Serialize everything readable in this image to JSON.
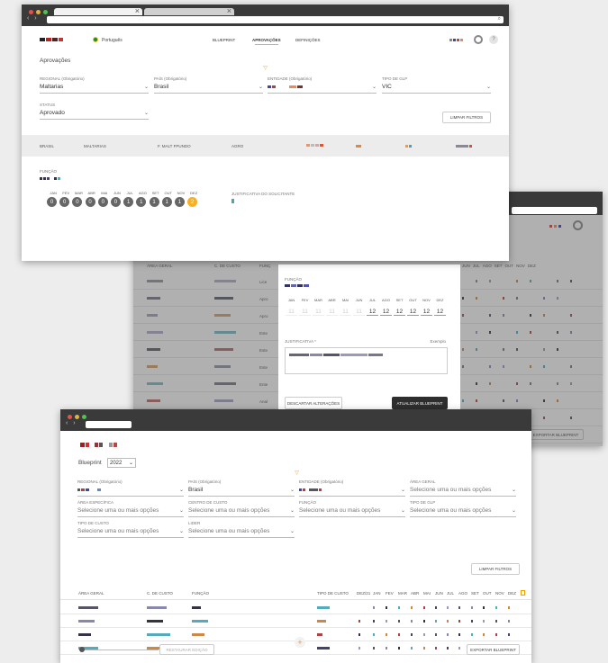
{
  "top": {
    "language": "Português",
    "nav": [
      "BLUEPRINT",
      "APROVAÇÕES",
      "DEFINIÇÕES"
    ],
    "page_title": "Aprovações",
    "filters": [
      {
        "label": "REGIONAL (Obrigatório)",
        "value": "Maltarias"
      },
      {
        "label": "PAÍS (Obrigatório)",
        "value": "Brasil"
      },
      {
        "label": "ENTIDADE (Obrigatório)",
        "value": ""
      },
      {
        "label": "TIPO DE GLP",
        "value": "VIC"
      }
    ],
    "status_label": "STATUS",
    "status_value": "Aprovado",
    "clear_filters": "LIMPAR FILTROS",
    "summary": [
      "BRASIL",
      "MALTARIAS",
      "F. MALT FPUNDO",
      "AGRO"
    ],
    "funcao_label": "FUNÇÃO",
    "months": [
      "JAN",
      "FEV",
      "MAR",
      "ABR",
      "MAI",
      "JUN",
      "JUL",
      "AGO",
      "SET",
      "OUT",
      "NOV",
      "DEZ"
    ],
    "month_values": [
      "0",
      "0",
      "0",
      "0",
      "0",
      "0",
      "1",
      "1",
      "1",
      "1",
      "1",
      "2"
    ],
    "justification_label": "JUSTIFICATIVA DO SOLICITANTE"
  },
  "middle": {
    "modal_funcao": "FUNÇÃO",
    "months": [
      "JAN",
      "FEV",
      "MAR",
      "ABR",
      "MAI",
      "JUN",
      "JUL",
      "AGO",
      "SET",
      "OUT",
      "NOV",
      "DEZ"
    ],
    "values": [
      "11",
      "11",
      "11",
      "11",
      "11",
      "11",
      "12",
      "12",
      "12",
      "12",
      "12",
      "12"
    ],
    "justification_label": "JUSTIFICATIVA *",
    "example_label": "Exemplo",
    "discard": "DESCARTAR ALTERAÇÕES",
    "update": "ATUALIZAR BLUEPRINT",
    "restore": "RESTAURAR EDIÇÃO",
    "export": "EXPORTAR BLUEPRINT",
    "columns": [
      "ÁREA GERAL",
      "C. DE CUSTO",
      "FUNÇ"
    ],
    "row_labels": [
      "Lice",
      "Apro",
      "Apro",
      "Este",
      "Este",
      "Este",
      "Ente",
      "Anal",
      "Gere",
      "Méd"
    ]
  },
  "bottom": {
    "title": "Blueprint",
    "year": "2022",
    "filters": [
      {
        "label": "REGIONAL (Obrigatório)",
        "value": ""
      },
      {
        "label": "PAÍS (Obrigatório)",
        "value": "Brasil"
      },
      {
        "label": "ENTIDADE (Obrigatório)",
        "value": ""
      },
      {
        "label": "ÁREA GERAL",
        "value": "Selecione uma ou mais opções"
      },
      {
        "label": "ÁREA ESPECÍFICA",
        "value": "Selecione uma ou mais opções"
      },
      {
        "label": "CENTRO DE CUSTO",
        "value": "Selecione uma ou mais opções"
      },
      {
        "label": "FUNÇÃO",
        "value": "Selecione uma ou mais opções"
      },
      {
        "label": "TIPO DE GLP",
        "value": "Selecione uma ou mais opções"
      },
      {
        "label": "TIPO DE CUSTO",
        "value": "Selecione uma ou mais opções"
      },
      {
        "label": "LIDER",
        "value": "Selecione uma ou mais opções"
      }
    ],
    "clear_filters": "LIMPAR FILTROS",
    "columns": [
      "ÁREA GERAL",
      "C. DE CUSTO",
      "FUNÇÃO",
      "TIPO DE CUSTO",
      "DEZ/21",
      "JAN",
      "FEV",
      "MAR",
      "ABR",
      "MAI",
      "JUN",
      "JUL",
      "AGO",
      "SET",
      "OUT",
      "NOV",
      "DEZ"
    ],
    "restore": "RESTAURAR EDIÇÃO",
    "export": "EXPORTAR BLUEPRINT"
  }
}
